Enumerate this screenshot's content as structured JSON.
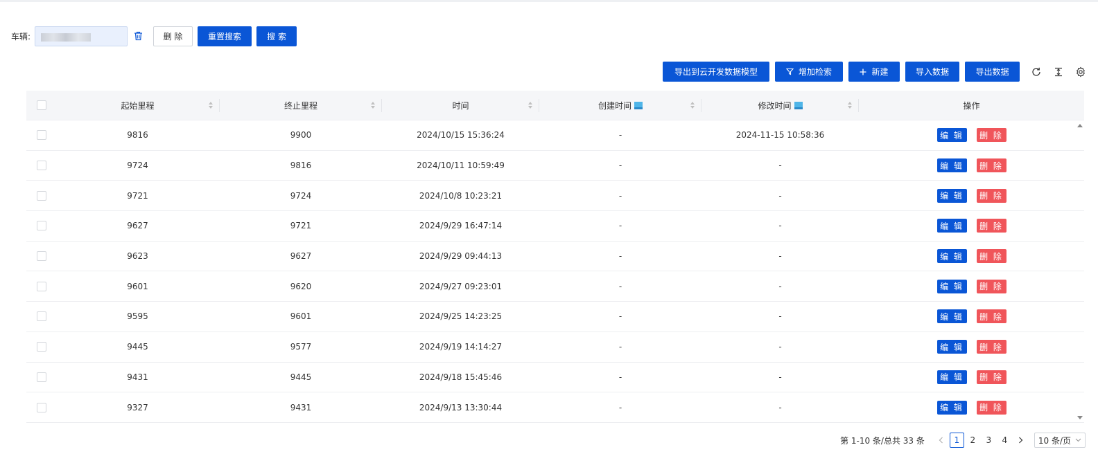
{
  "search": {
    "vehicle_label": "车辆:",
    "delete_label": "删 除",
    "reset_label": "重置搜索",
    "search_label": "搜 索"
  },
  "toolbar": {
    "export_cloud_label": "导出到云开发数据模型",
    "add_filter_label": "增加检索",
    "new_label": "新建",
    "import_label": "导入数据",
    "export_label": "导出数据",
    "icons": [
      "refresh-icon",
      "column-height-icon",
      "settings-icon"
    ]
  },
  "table": {
    "columns": [
      "起始里程",
      "终止里程",
      "时间",
      "创建时间",
      "修改时间",
      "操作"
    ],
    "edit_label": "编 辑",
    "delete_label": "删 除",
    "rows": [
      {
        "start": "9816",
        "end": "9900",
        "time": "2024/10/15 15:36:24",
        "created": "-",
        "modified": "2024-11-15 10:58:36"
      },
      {
        "start": "9724",
        "end": "9816",
        "time": "2024/10/11 10:59:49",
        "created": "-",
        "modified": "-"
      },
      {
        "start": "9721",
        "end": "9724",
        "time": "2024/10/8 10:23:21",
        "created": "-",
        "modified": "-"
      },
      {
        "start": "9627",
        "end": "9721",
        "time": "2024/9/29 16:47:14",
        "created": "-",
        "modified": "-"
      },
      {
        "start": "9623",
        "end": "9627",
        "time": "2024/9/29 09:44:13",
        "created": "-",
        "modified": "-"
      },
      {
        "start": "9601",
        "end": "9620",
        "time": "2024/9/27 09:23:01",
        "created": "-",
        "modified": "-"
      },
      {
        "start": "9595",
        "end": "9601",
        "time": "2024/9/25 14:23:25",
        "created": "-",
        "modified": "-"
      },
      {
        "start": "9445",
        "end": "9577",
        "time": "2024/9/19 14:14:27",
        "created": "-",
        "modified": "-"
      },
      {
        "start": "9431",
        "end": "9445",
        "time": "2024/9/18 15:45:46",
        "created": "-",
        "modified": "-"
      },
      {
        "start": "9327",
        "end": "9431",
        "time": "2024/9/13 13:30:44",
        "created": "-",
        "modified": "-"
      }
    ]
  },
  "pagination": {
    "total_text": "第 1-10 条/总共 33 条",
    "pages": [
      "1",
      "2",
      "3",
      "4"
    ],
    "current": "1",
    "page_size": "10 条/页"
  },
  "colors": {
    "primary": "#0a56d6",
    "danger": "#f0555a",
    "header_bg": "#f5f6f8"
  }
}
